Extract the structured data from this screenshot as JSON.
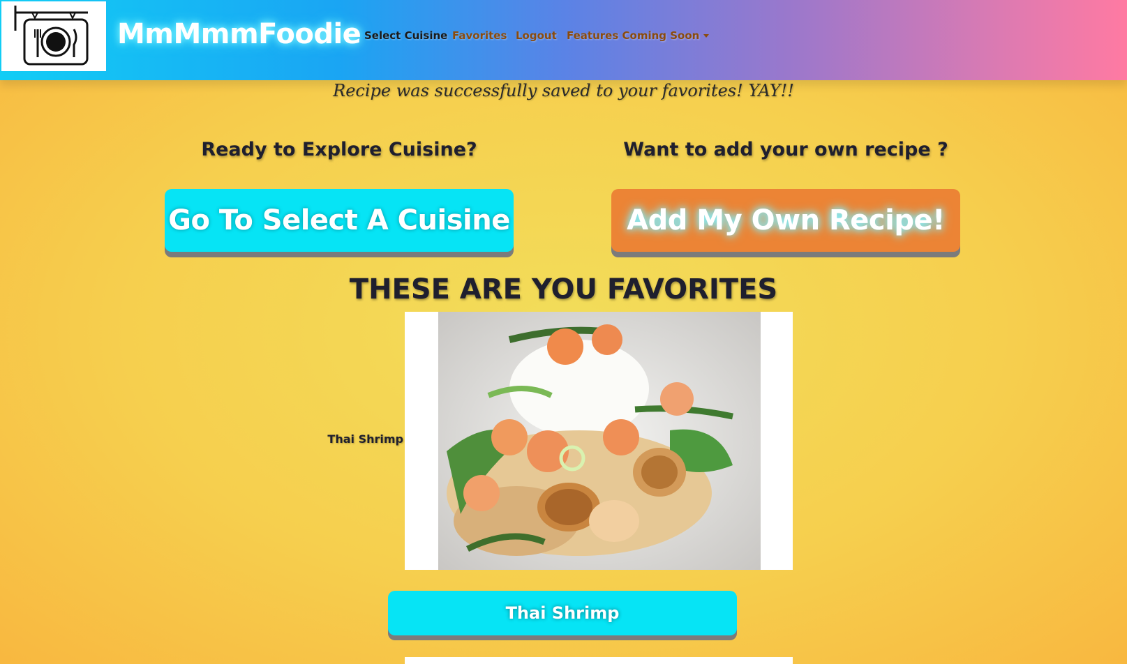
{
  "navbar": {
    "brand": "MmMmmFoodie",
    "logo_icon": "restaurant-sign-plate-icon",
    "links": [
      {
        "label": "Select Cuisine",
        "active": true
      },
      {
        "label": "Favorites",
        "active": false
      },
      {
        "label": "Logout",
        "active": false
      },
      {
        "label": "Features Coming Soon",
        "dropdown": true
      }
    ]
  },
  "flash_message": "Recipe was successfully saved to your favorites! YAY!!",
  "explore": {
    "prompt": "Ready to Explore Cuisine?",
    "button": "Go To Select A Cuisine"
  },
  "add_recipe": {
    "prompt": "Want to add your own recipe ?",
    "button": "Add My Own Recipe!"
  },
  "favorites": {
    "title": "THESE ARE YOU FAVORITES",
    "items": [
      {
        "name": "Thai Shrimp",
        "button": "Thai Shrimp",
        "image": "thai-shrimp-dish-photo"
      }
    ]
  },
  "colors": {
    "cyan_button": "#06e4f5",
    "orange_button": "#ec8435",
    "nav_link": "#8a4b0d"
  }
}
